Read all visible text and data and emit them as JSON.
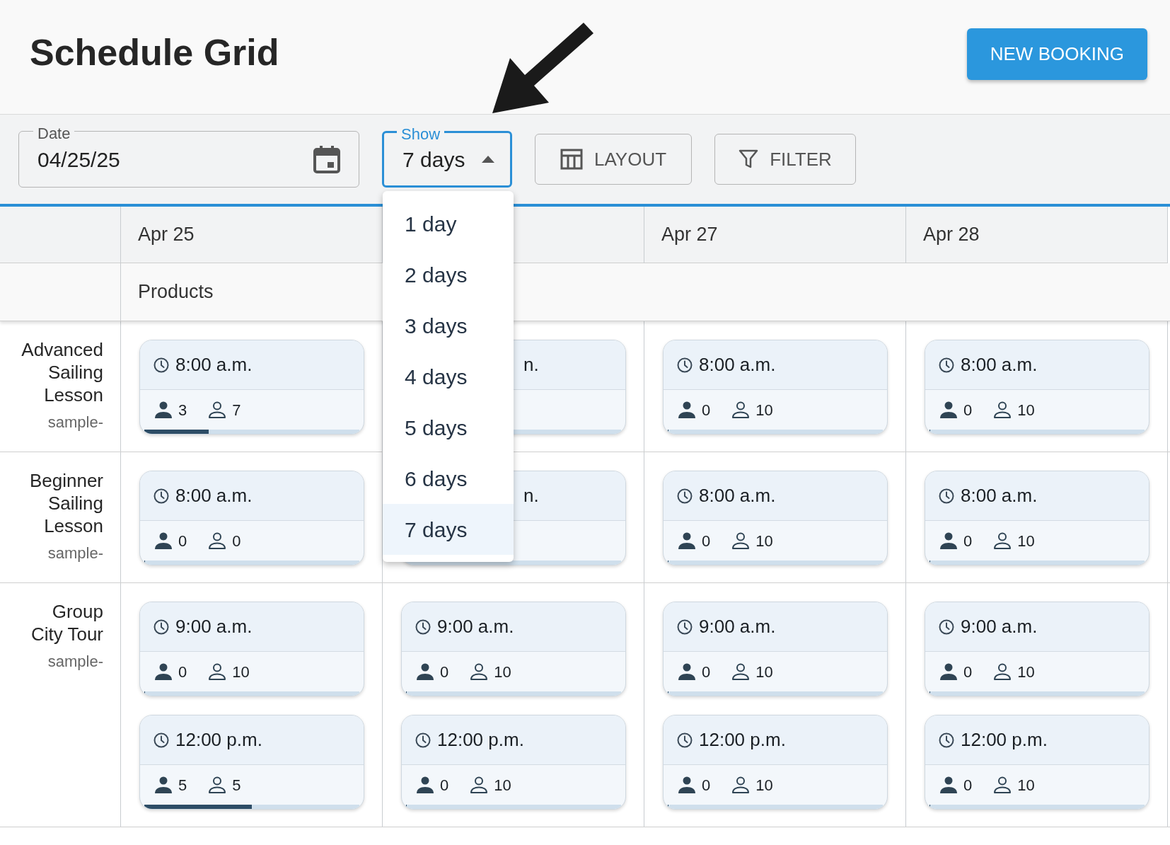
{
  "title": "Schedule Grid",
  "new_booking": "NEW BOOKING",
  "date_field": {
    "label": "Date",
    "value": "04/25/25"
  },
  "show_field": {
    "label": "Show",
    "value": "7 days",
    "expanded": true
  },
  "layout_button": "LAYOUT",
  "filter_button": "FILTER",
  "show_options": [
    {
      "label": "1 day",
      "selected": false
    },
    {
      "label": "2 days",
      "selected": false
    },
    {
      "label": "3 days",
      "selected": false
    },
    {
      "label": "4 days",
      "selected": false
    },
    {
      "label": "5 days",
      "selected": false
    },
    {
      "label": "6 days",
      "selected": false
    },
    {
      "label": "7 days",
      "selected": true
    }
  ],
  "columns": [
    {
      "kind": "day",
      "date": "Apr 25"
    },
    {
      "kind": "covered"
    },
    {
      "kind": "day",
      "date": "Apr 27"
    },
    {
      "kind": "day",
      "date": "Apr 28"
    }
  ],
  "group_label": "Products",
  "rows": [
    {
      "name": "Advanced Sailing Lesson",
      "code": "sample-",
      "cells": [
        [
          {
            "kind": "full",
            "time": "8:00 a.m.",
            "booked": "3",
            "capacity": "7",
            "level": 0.3
          }
        ],
        [
          {
            "kind": "partial",
            "time": "n."
          }
        ],
        [
          {
            "kind": "full",
            "time": "8:00 a.m.",
            "booked": "0",
            "capacity": "10",
            "level": 0
          }
        ],
        [
          {
            "kind": "full",
            "time": "8:00 a.m.",
            "booked": "0",
            "capacity": "10",
            "level": 0
          }
        ]
      ]
    },
    {
      "name": "Beginner Sailing Lesson",
      "code": "sample-",
      "cells": [
        [
          {
            "kind": "full",
            "time": "8:00 a.m.",
            "booked": "0",
            "capacity": "0",
            "level": 0
          }
        ],
        [
          {
            "kind": "partial",
            "time": "n."
          }
        ],
        [
          {
            "kind": "full",
            "time": "8:00 a.m.",
            "booked": "0",
            "capacity": "10",
            "level": 0
          }
        ],
        [
          {
            "kind": "full",
            "time": "8:00 a.m.",
            "booked": "0",
            "capacity": "10",
            "level": 0
          }
        ]
      ]
    },
    {
      "name": "Group City Tour",
      "code": "sample-",
      "cells": [
        [
          {
            "kind": "full",
            "time": "9:00 a.m.",
            "booked": "0",
            "capacity": "10",
            "level": 0
          },
          {
            "kind": "full",
            "time": "12:00 p.m.",
            "booked": "5",
            "capacity": "5",
            "level": 0.5
          }
        ],
        [
          {
            "kind": "full",
            "time": "9:00 a.m.",
            "booked": "0",
            "capacity": "10",
            "level": 0
          },
          {
            "kind": "full",
            "time": "12:00 p.m.",
            "booked": "0",
            "capacity": "10",
            "level": 0
          }
        ],
        [
          {
            "kind": "full",
            "time": "9:00 a.m.",
            "booked": "0",
            "capacity": "10",
            "level": 0
          },
          {
            "kind": "full",
            "time": "12:00 p.m.",
            "booked": "0",
            "capacity": "10",
            "level": 0
          }
        ],
        [
          {
            "kind": "full",
            "time": "9:00 a.m.",
            "booked": "0",
            "capacity": "10",
            "level": 0
          },
          {
            "kind": "full",
            "time": "12:00 p.m.",
            "booked": "0",
            "capacity": "10",
            "level": 0
          }
        ]
      ]
    }
  ]
}
